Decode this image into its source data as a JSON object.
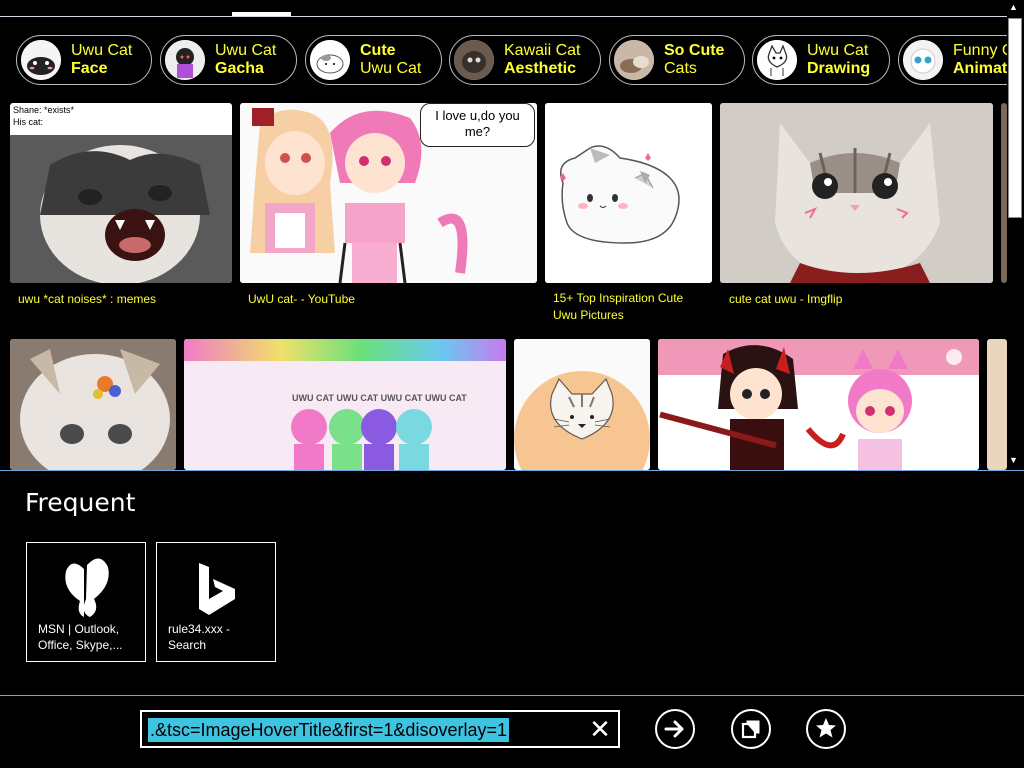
{
  "browser": {
    "address_value": ".&tsc=ImageHoverTitle&first=1&disoverlay=1",
    "clear_symbol": "✕"
  },
  "related_searches": [
    {
      "line1": "Uwu Cat",
      "line2": "Face",
      "bold_line": 2
    },
    {
      "line1": "Uwu Cat",
      "line2": "Gacha",
      "bold_line": 2
    },
    {
      "line1": "Cute",
      "line2": "Uwu Cat",
      "bold_line": 1
    },
    {
      "line1": "Kawaii Cat",
      "line2": "Aesthetic",
      "bold_line": 2
    },
    {
      "line1": "So Cute",
      "line2": "Cats",
      "bold_line": 1
    },
    {
      "line1": "Uwu Cat",
      "line2": "Drawing",
      "bold_line": 2
    },
    {
      "line1": "Funny C",
      "line2": "Animat",
      "bold_line": 2
    }
  ],
  "images": {
    "meme_top_text": "Shane: *exists*",
    "meme_sub_text": "His cat:",
    "speech_bubble": "I love u,do you me?",
    "gacha_banner": "UWU CAT UWU CAT UWU CAT UWU CAT",
    "captions": [
      "uwu *cat noises* : memes",
      "UwU cat- - YouTube",
      "15+ Top Inspiration Cute Uwu Pictures",
      "cute cat uwu - Imgflip"
    ]
  },
  "frequent": {
    "title": "Frequent",
    "tiles": [
      {
        "label": "MSN | Outlook, Office, Skype,...",
        "icon": "msn-butterfly-icon"
      },
      {
        "label": "rule34.xxx - Search",
        "icon": "bing-logo-icon"
      }
    ]
  },
  "colors": {
    "caption": "#ffff33",
    "url_highlight": "#3ec3e0",
    "divider": "#6fa8dc"
  }
}
